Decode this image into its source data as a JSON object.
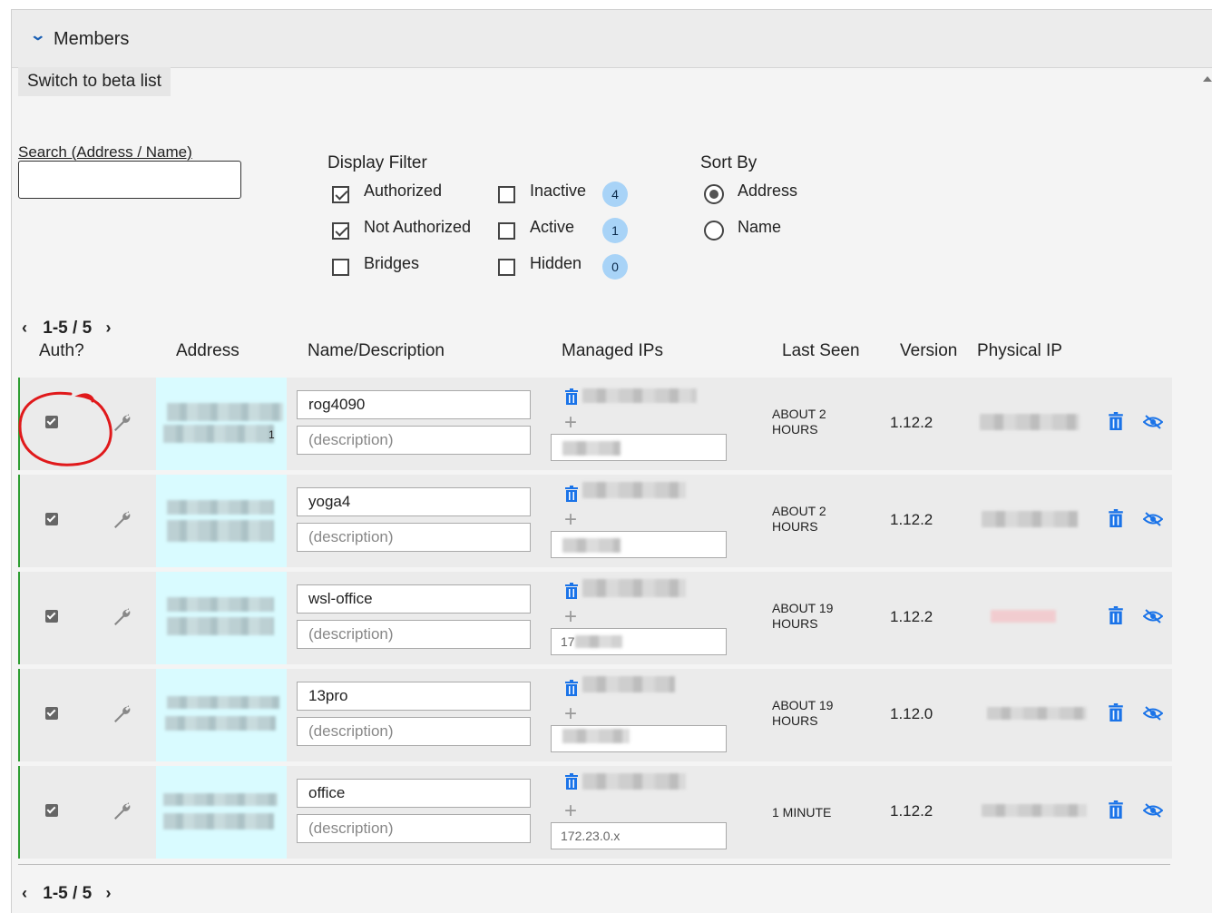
{
  "panel": {
    "title": "Members",
    "chevron": "chevron-down-icon"
  },
  "beta_button": "Switch to beta list",
  "search": {
    "label": "Search (Address / Name)",
    "value": "",
    "placeholder": ""
  },
  "display_filter": {
    "title": "Display Filter",
    "options": [
      {
        "label": "Authorized",
        "checked": true
      },
      {
        "label": "Not Authorized",
        "checked": true
      },
      {
        "label": "Bridges",
        "checked": false
      },
      {
        "label": "Inactive",
        "checked": false,
        "count": "4"
      },
      {
        "label": "Active",
        "checked": false,
        "count": "1"
      },
      {
        "label": "Hidden",
        "checked": false,
        "count": "0"
      }
    ]
  },
  "sort_by": {
    "title": "Sort By",
    "options": [
      {
        "label": "Address",
        "selected": true
      },
      {
        "label": "Name",
        "selected": false
      }
    ]
  },
  "pager": {
    "text": "1-5 / 5"
  },
  "columns": [
    "Auth?",
    "Address",
    "Name/Description",
    "Managed IPs",
    "Last Seen",
    "Version",
    "Physical IP"
  ],
  "members": [
    {
      "name": "rog4090",
      "description_placeholder": "(description)",
      "ip_input": "",
      "last_seen": "ABOUT 2 HOURS",
      "last_seen_1": "ABOUT 2",
      "last_seen_2": "HOURS",
      "version": "1.12.2",
      "addr_suffix": "1"
    },
    {
      "name": "yoga4",
      "description_placeholder": "(description)",
      "ip_input": "",
      "last_seen_1": "ABOUT 2",
      "last_seen_2": "HOURS",
      "version": "1.12.2"
    },
    {
      "name": "wsl-office",
      "description_placeholder": "(description)",
      "ip_input": "17",
      "last_seen_1": "ABOUT 19",
      "last_seen_2": "HOURS",
      "version": "1.12.2"
    },
    {
      "name": "13pro",
      "description_placeholder": "(description)",
      "ip_input": "",
      "last_seen_1": "ABOUT 19",
      "last_seen_2": "HOURS",
      "version": "1.12.0"
    },
    {
      "name": "office",
      "description_placeholder": "(description)",
      "ip_input": "172.23.0.x",
      "last_seen_1": "1 MINUTE",
      "last_seen_2": "",
      "version": "1.12.2"
    }
  ],
  "colors": {
    "accent": "#1a5fb4",
    "authorized_border": "#2e9e32",
    "address_bg": "#d9fbff",
    "badge": "#a8d3f7",
    "annotation": "#e0191b"
  }
}
